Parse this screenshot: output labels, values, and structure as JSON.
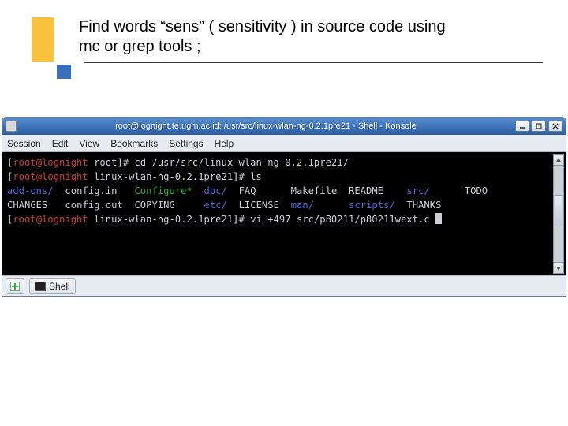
{
  "slide": {
    "title_line1": "Find words  “sens” ( sensitivity ) in source code using",
    "title_line2": "mc or grep tools ;"
  },
  "window": {
    "title": "root@lognight.te.ugm.ac.id: /usr/src/linux-wlan-ng-0.2.1pre21 - Shell - Konsole",
    "menus": [
      "Session",
      "Edit",
      "View",
      "Bookmarks",
      "Settings",
      "Help"
    ],
    "tab_label": "Shell"
  },
  "terminal": {
    "prompt1_open": "[",
    "prompt1_userhost": "root@lognight",
    "prompt1_cwd": " root",
    "prompt1_close": "]# ",
    "cmd1": "cd /usr/src/linux-wlan-ng-0.2.1pre21/",
    "prompt2_open": "[",
    "prompt2_userhost": "root@lognight",
    "prompt2_cwd": " linux-wlan-ng-0.2.1pre21",
    "prompt2_close": "]# ",
    "cmd2": "ls",
    "ls_row1": {
      "c1": "add-ons/",
      "c2": "config.in",
      "c3": "Configure*",
      "c4": "doc/",
      "c5": "FAQ",
      "c6": "Makefile",
      "c7": "README",
      "c8": "src/",
      "c9": "TODO"
    },
    "ls_row2": {
      "c1": "CHANGES",
      "c2": "config.out",
      "c3": "COPYING",
      "c4": "etc/",
      "c5": "LICENSE",
      "c6": "man/",
      "c7": "scripts/",
      "c8": "THANKS"
    },
    "prompt3_open": "[",
    "prompt3_userhost": "root@lognight",
    "prompt3_cwd": " linux-wlan-ng-0.2.1pre21",
    "prompt3_close": "]# ",
    "cmd3": "vi +497 src/p80211/p80211wext.c"
  }
}
